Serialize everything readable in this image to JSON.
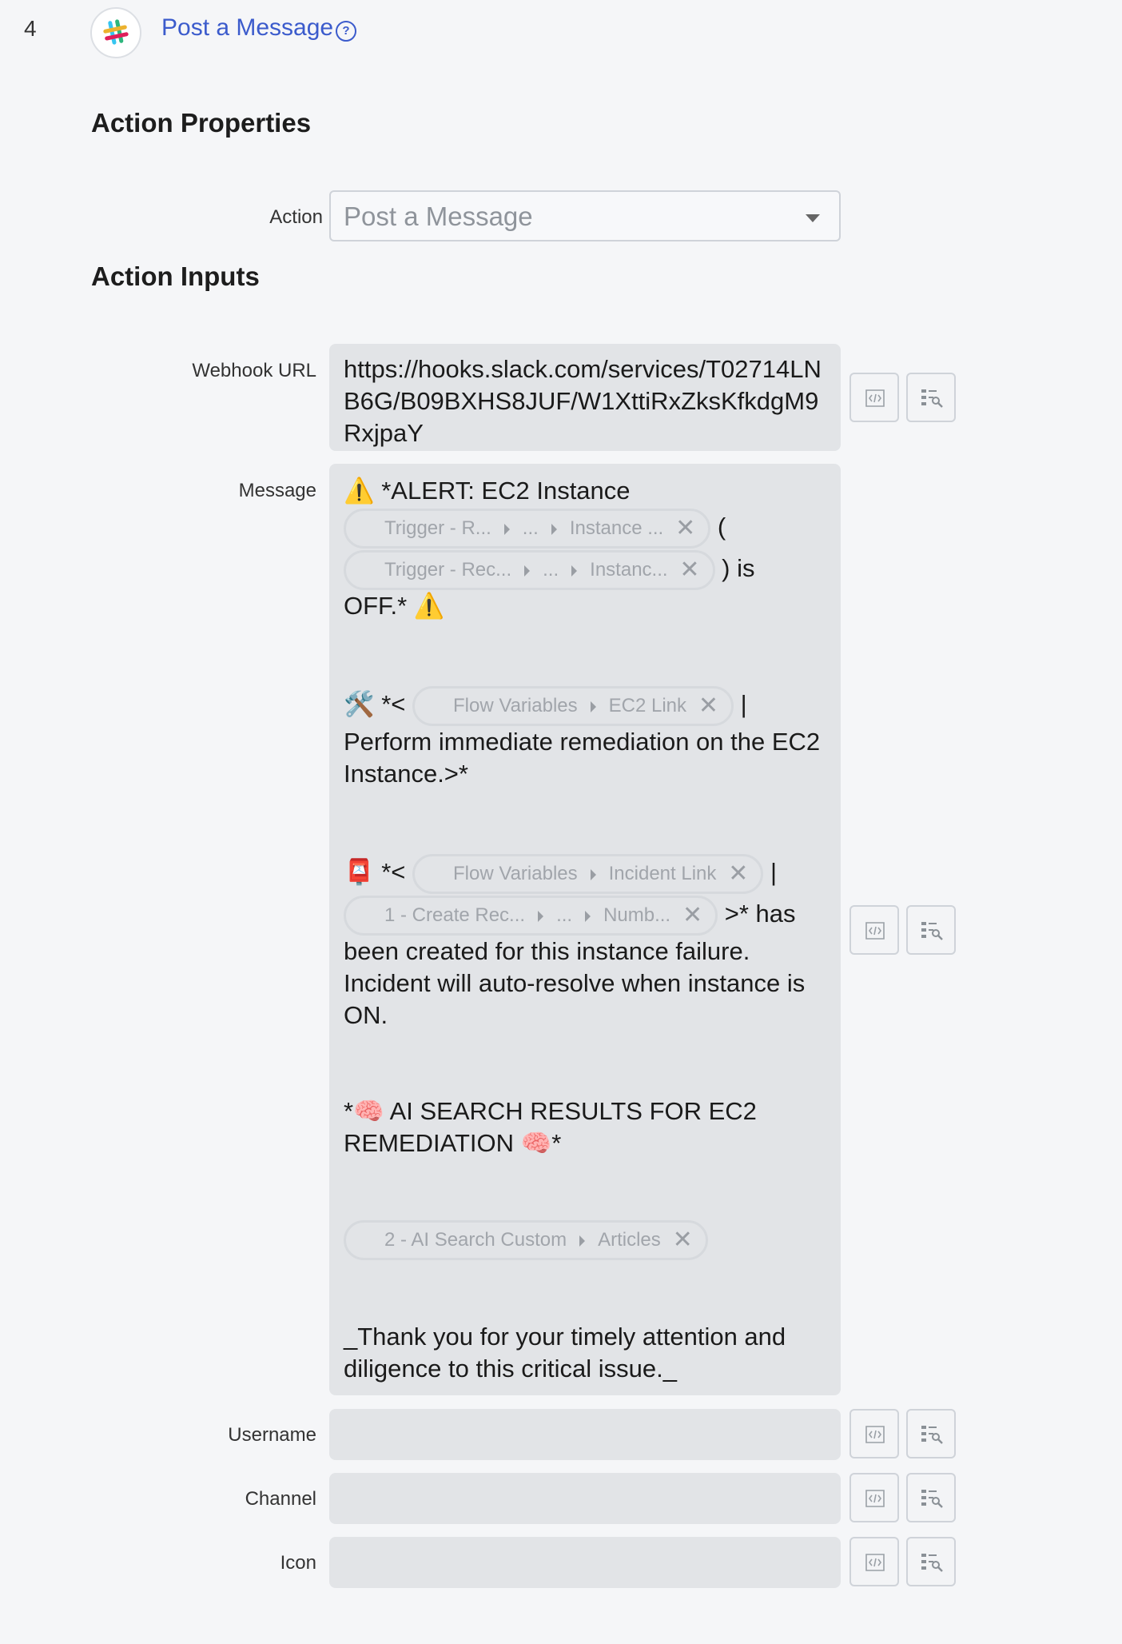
{
  "step": {
    "number": "4",
    "title": "Post a Message",
    "help_icon": "help-circle-icon",
    "logo_icon": "slack-logo-icon"
  },
  "sections": {
    "properties_title": "Action Properties",
    "inputs_title": "Action Inputs"
  },
  "action": {
    "label": "Action",
    "value": "Post a Message"
  },
  "webhook": {
    "label": "Webhook URL",
    "value": "https://hooks.slack.com/services/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"
  },
  "message": {
    "label": "Message",
    "line1": "⚠️ *ALERT: EC2 Instance",
    "pill1": [
      "Trigger - R...",
      "...",
      "Instance ..."
    ],
    "text_paren_open": "(",
    "pill2": [
      "Trigger - Rec...",
      "...",
      "Instanc..."
    ],
    "text_is": ") is",
    "text_off": "OFF.* ⚠️",
    "tools_prefix": "🛠️ *<",
    "pill3": [
      "Flow Variables",
      "EC2 Link"
    ],
    "pipe1": "|",
    "remediation_text": "Perform immediate remediation on the EC2 Instance.>*",
    "postbox_prefix": "📮 *<",
    "pill4": [
      "Flow Variables",
      "Incident Link"
    ],
    "pipe2": "|",
    "pill5": [
      "1 - Create Rec...",
      "...",
      "Numb..."
    ],
    "has_text": ">* has",
    "incident_text": "been created for this instance failure. Incident will auto-resolve when instance is ON.",
    "ai_text": "*🧠 AI SEARCH RESULTS FOR EC2 REMEDIATION 🧠*",
    "pill6": [
      "2 - AI Search Custom",
      "Articles"
    ],
    "thanks_text": "_Thank you for your timely attention and diligence to this critical issue._"
  },
  "username": {
    "label": "Username",
    "value": ""
  },
  "channel": {
    "label": "Channel",
    "value": ""
  },
  "icon": {
    "label": "Icon",
    "value": ""
  },
  "buttons": {
    "script_icon": "script-code-icon",
    "data_pill_icon": "data-pill-picker-icon"
  }
}
